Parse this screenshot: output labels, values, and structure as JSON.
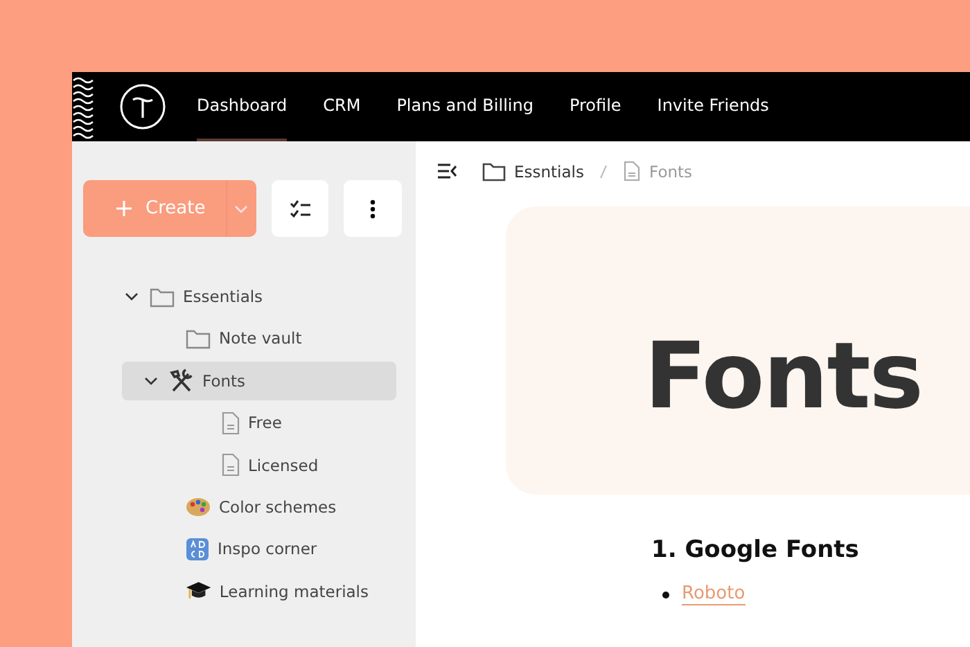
{
  "nav": {
    "tabs": [
      {
        "label": "Dashboard",
        "selected": true
      },
      {
        "label": "CRM",
        "selected": false
      },
      {
        "label": "Plans and Billing",
        "selected": false
      },
      {
        "label": "Profile",
        "selected": false
      },
      {
        "label": "Invite Friends",
        "selected": false
      }
    ]
  },
  "sidebar": {
    "create_button": {
      "label": "Create"
    },
    "tree": [
      {
        "label": "Essentials",
        "kind": "folder",
        "expanded": true,
        "selected": false,
        "children": [
          {
            "label": "Note vault",
            "kind": "folder",
            "selected": false
          },
          {
            "label": "Fonts",
            "kind": "tools",
            "expanded": true,
            "selected": true,
            "children": [
              {
                "label": "Free",
                "kind": "doc",
                "selected": false
              },
              {
                "label": "Licensed",
                "kind": "doc",
                "selected": false
              }
            ]
          },
          {
            "label": "Color schemes",
            "kind": "palette",
            "selected": false
          },
          {
            "label": "Inspo corner",
            "kind": "letters",
            "selected": false
          },
          {
            "label": "Learning materials",
            "kind": "cap",
            "selected": false
          }
        ]
      }
    ]
  },
  "breadcrumb": [
    {
      "label": "Essntials",
      "kind": "folder"
    },
    {
      "label": "Fonts",
      "kind": "doc"
    }
  ],
  "page": {
    "title": "Fonts",
    "heading": "1. Google Fonts",
    "list": [
      "Roboto"
    ]
  }
}
